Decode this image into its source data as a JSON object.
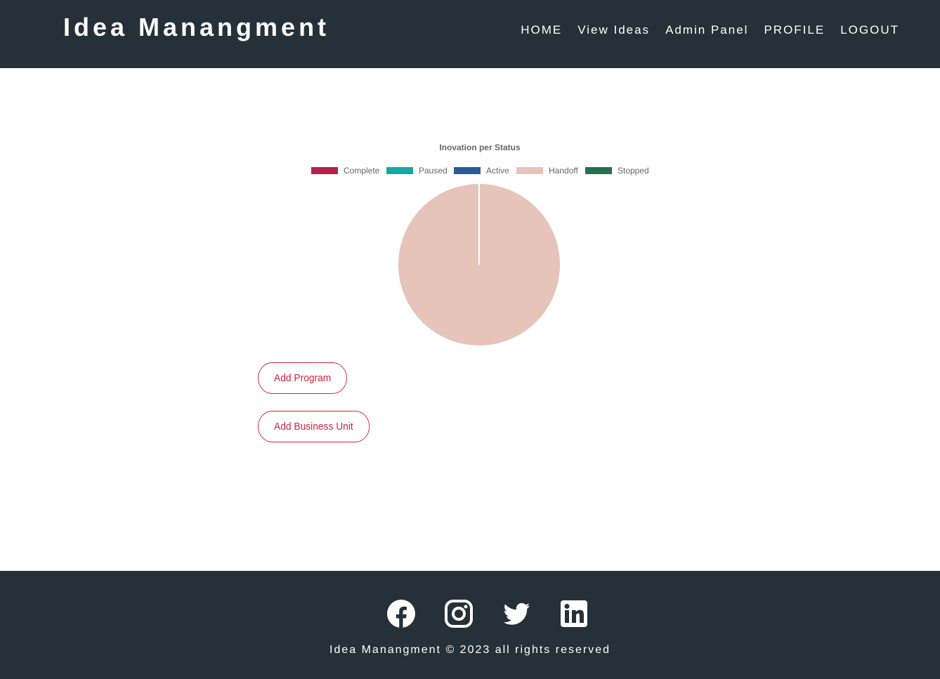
{
  "header": {
    "brand": "Idea Manangment",
    "nav": [
      "HOME",
      "View Ideas",
      "Admin Panel",
      "PROFILE",
      "LOGOUT"
    ]
  },
  "chart_data": {
    "type": "pie",
    "title": "Inovation per Status",
    "legend_position": "top",
    "categories": [
      "Complete",
      "Paused",
      "Active",
      "Handoff",
      "Stopped"
    ],
    "values": [
      0,
      0,
      0,
      1,
      0
    ],
    "colors": [
      "#b9204a",
      "#16a8a6",
      "#2c5a9a",
      "#e6c4ba",
      "#22734a"
    ]
  },
  "actions": {
    "add_program": "Add Program",
    "add_business_unit": "Add Business Unit"
  },
  "footer": {
    "social_icons": [
      "facebook-icon",
      "instagram-icon",
      "twitter-icon",
      "linkedin-icon"
    ],
    "copyright": "Idea Manangment © 2023 all rights reserved"
  }
}
